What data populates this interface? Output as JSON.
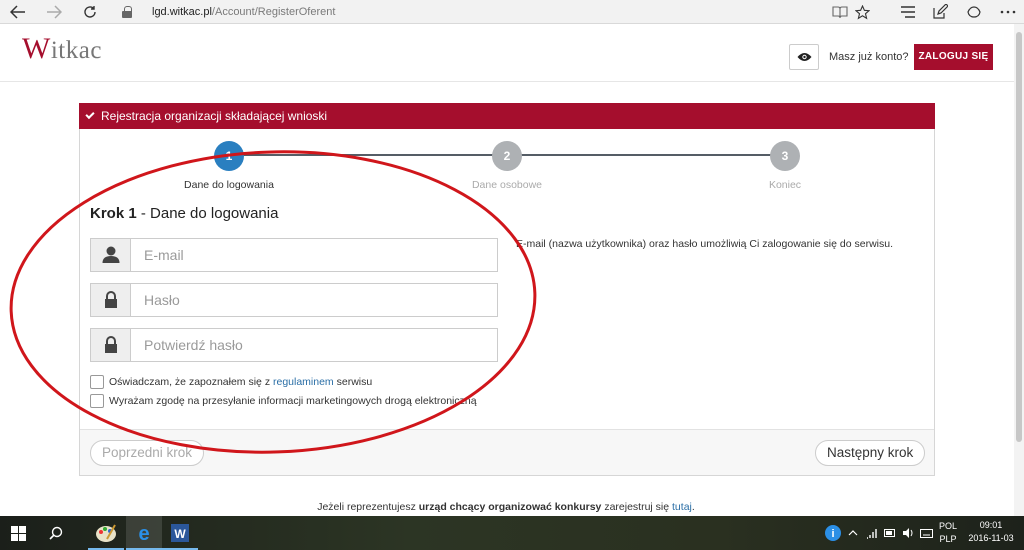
{
  "browser": {
    "url_domain": "lgd.witkac.pl",
    "url_path": "/Account/RegisterOferent"
  },
  "header": {
    "logo_initial": "W",
    "logo_rest": "itkac",
    "have_account": "Masz już konto?",
    "login_label": "ZALOGUJ SIĘ"
  },
  "panel": {
    "title": "Rejestracja organizacji składającej wnioski",
    "steps": [
      {
        "number": "1",
        "label": "Dane do logowania",
        "state": "active"
      },
      {
        "number": "2",
        "label": "Dane osobowe",
        "state": "inactive"
      },
      {
        "number": "3",
        "label": "Koniec",
        "state": "inactive"
      }
    ],
    "step_title_bold": "Krok 1",
    "step_title_rest": " - Dane do logowania",
    "fields": {
      "email_placeholder": "E-mail",
      "password_placeholder": "Hasło",
      "confirm_placeholder": "Potwierdź hasło"
    },
    "checkbox_terms_pre": "Oświadczam, że zapoznałem się z ",
    "checkbox_terms_link": "regulaminem",
    "checkbox_terms_post": " serwisu",
    "checkbox_marketing": "Wyrażam zgodę na przesyłanie informacji marketingowych drogą elektroniczną",
    "info_text": "E-mail (nazwa użytkownika) oraz hasło umożliwią Ci zalogowanie się do serwisu.",
    "prev_label": "Poprzedni krok",
    "next_label": "Następny krok"
  },
  "bottom_note": {
    "pre": "Jeżeli reprezentujesz ",
    "bold": "urząd chcący organizować konkursy",
    "mid": " zarejestruj się ",
    "link": "tutaj",
    "post": "."
  },
  "taskbar": {
    "lang_top": "POL",
    "lang_bottom": "PLP",
    "time": "09:01",
    "date": "2016-11-03"
  },
  "colors": {
    "brand": "#a50e2d",
    "step_active": "#2a7fc0",
    "step_inactive": "#aeb1b4",
    "annotation": "#d0161b"
  },
  "icons": [
    "back-icon",
    "forward-icon",
    "refresh-icon",
    "lock-icon",
    "reading-view-icon",
    "favorite-star-icon",
    "hub-icon",
    "web-note-icon",
    "share-icon",
    "eye-icon",
    "checkmark-icon",
    "user-icon",
    "padlock-icon",
    "windows-start-icon",
    "search-icon",
    "paint-app-icon",
    "edge-browser-icon",
    "word-app-icon",
    "notification-icon",
    "chevron-up-icon",
    "network-icon",
    "volume-icon",
    "keyboard-icon",
    "action-center-icon"
  ]
}
